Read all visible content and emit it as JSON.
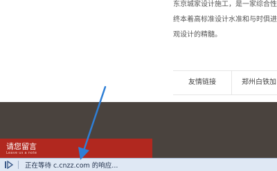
{
  "intro": {
    "lines": [
      "东京城家设计施工，是一家综合性",
      "终本着高标准设计水准和与时俱进",
      "观设计的精髓。"
    ]
  },
  "partners": {
    "label": "友情链接",
    "first_link": "郑州白铁加"
  },
  "message_tab": {
    "title": "请您留言",
    "subtitle": "Leave us a note"
  },
  "status_bar": {
    "text": "正在等待 c.cnzz.com 的响应..."
  },
  "colors": {
    "footer_bg": "#4a433e",
    "message_tab_bg": "#b1281f",
    "status_bar_bg": "#dfe8f4",
    "arrow": "#2f7fd6"
  },
  "icons": {
    "status_play": "play-icon",
    "annotation_arrow": "arrow-annotation"
  }
}
